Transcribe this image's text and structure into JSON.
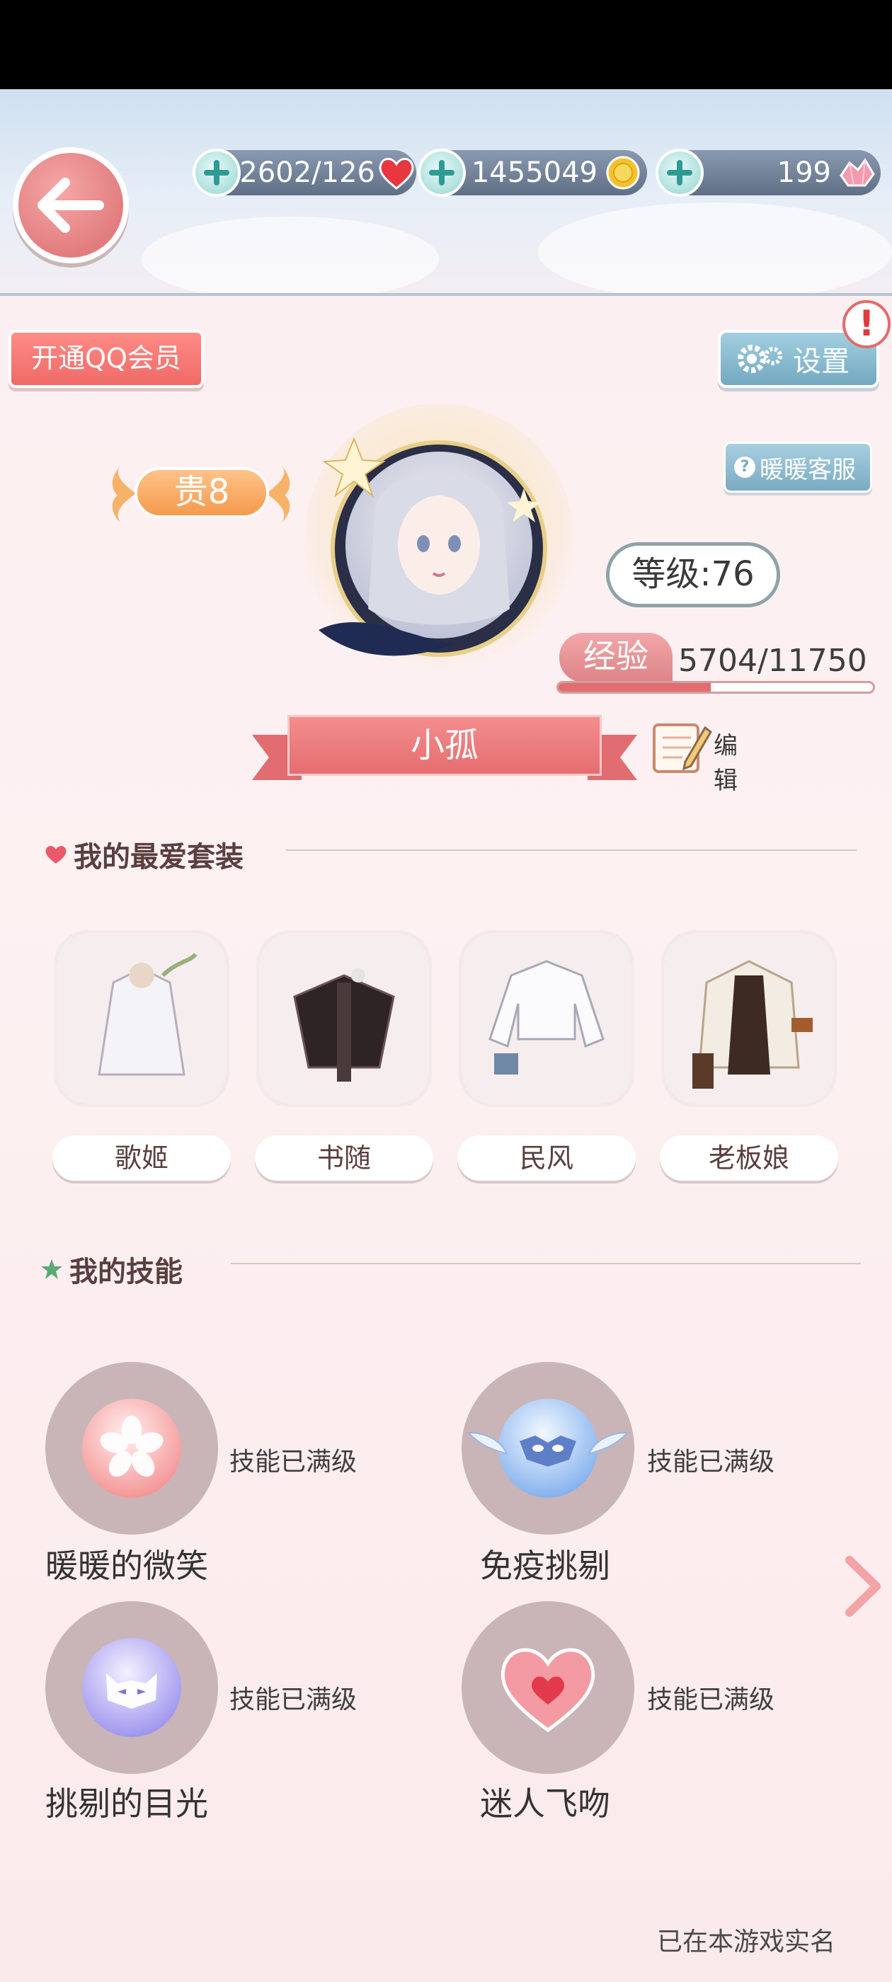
{
  "header": {
    "back_label": "",
    "currencies": [
      {
        "value": "2602/126",
        "icon": "heart-stamina-icon"
      },
      {
        "value": "1455049",
        "icon": "gold-coin-icon"
      },
      {
        "value": "199",
        "icon": "diamond-crystal-icon"
      }
    ]
  },
  "profile": {
    "vip_member_button": "开通QQ会员",
    "settings_button": "设置",
    "support_button": "暖暖客服",
    "vip_level": "贵8",
    "level": "等级:76",
    "exp_label": "经验",
    "exp_value": "5704/11750",
    "exp_progress": 0.485,
    "name": "小孤",
    "edit_button": "编 辑"
  },
  "favorites": {
    "title": "我的最爱套装",
    "outfits": [
      {
        "label": "歌姬"
      },
      {
        "label": "书随"
      },
      {
        "label": "民风"
      },
      {
        "label": "老板娘"
      }
    ]
  },
  "skills": {
    "title": "我的技能",
    "items": [
      {
        "name": "暖暖的微笑",
        "status": "技能已满级",
        "icon": "sakura-orb-icon"
      },
      {
        "name": "免疫挑剔",
        "status": "技能已满级",
        "icon": "winged-mask-orb-icon"
      },
      {
        "name": "挑剔的目光",
        "status": "技能已满级",
        "icon": "cat-mask-orb-icon"
      },
      {
        "name": "迷人飞吻",
        "status": "技能已满级",
        "icon": "heart-kiss-icon"
      }
    ]
  },
  "footer": {
    "note": "已在本游戏实名"
  },
  "colors": {
    "accent": "#e56d70",
    "currency_bar": "#5f6f86",
    "settings": "#73a9c1"
  }
}
